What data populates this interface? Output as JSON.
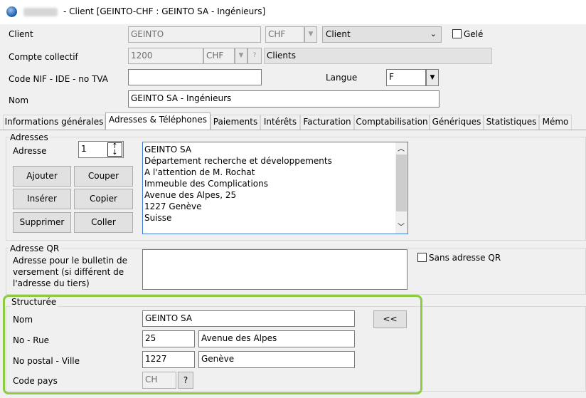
{
  "window": {
    "title": "- Client [GEINTO-CHF : GEINTO SA - Ingénieurs]"
  },
  "header": {
    "client_label": "Client",
    "client_code": "GEINTO",
    "client_currency": "CHF",
    "client_question": "?",
    "client_type": "Client",
    "gele_label": "Gelé",
    "compte_label": "Compte collectif",
    "compte_value": "1200",
    "compte_currency": "CHF",
    "compte_question": "?",
    "compte_name": "Clients",
    "nif_label": "Code NIF - IDE - no TVA",
    "nif_value": "",
    "langue_label": "Langue",
    "langue_value": "F",
    "nom_label": "Nom",
    "nom_value": "GEINTO SA - Ingénieurs"
  },
  "tabs": [
    "Informations générales",
    "Adresses & Téléphones",
    "Paiements",
    "Intérêts",
    "Facturation",
    "Comptabilisation",
    "Génériques",
    "Statistiques",
    "Mémo"
  ],
  "adresses": {
    "group_title": "Adresses",
    "adresse_label": "Adresse",
    "adresse_index": "1",
    "buttons": {
      "ajouter": "Ajouter",
      "couper": "Couper",
      "inserer": "Insérer",
      "copier": "Copier",
      "supprimer": "Supprimer",
      "coller": "Coller"
    },
    "lines": [
      "GEINTO SA",
      "Département recherche et développements",
      "A l'attention de M. Rochat",
      "Immeuble des Complications",
      "Avenue des Alpes, 25",
      "1227 Genève",
      "Suisse"
    ]
  },
  "qr": {
    "group_title": "Adresse QR",
    "description": [
      "Adresse pour le bulletin de",
      "versement (si différent de",
      "l'adresse du tiers)"
    ],
    "sans_label": "Sans adresse QR"
  },
  "structuree": {
    "group_title": "Structurée",
    "nom_label": "Nom",
    "nom_value": "GEINTO SA",
    "rue_label": "No - Rue",
    "rue_no": "25",
    "rue_value": "Avenue des Alpes",
    "ville_label": "No postal - Ville",
    "postal": "1227",
    "ville": "Genève",
    "pays_label": "Code pays",
    "pays_value": "CH",
    "pays_question": "?",
    "copy_button": "<<"
  },
  "colors": {
    "highlight": "#8ccd3f",
    "window_bg": "#f0f0f0"
  }
}
